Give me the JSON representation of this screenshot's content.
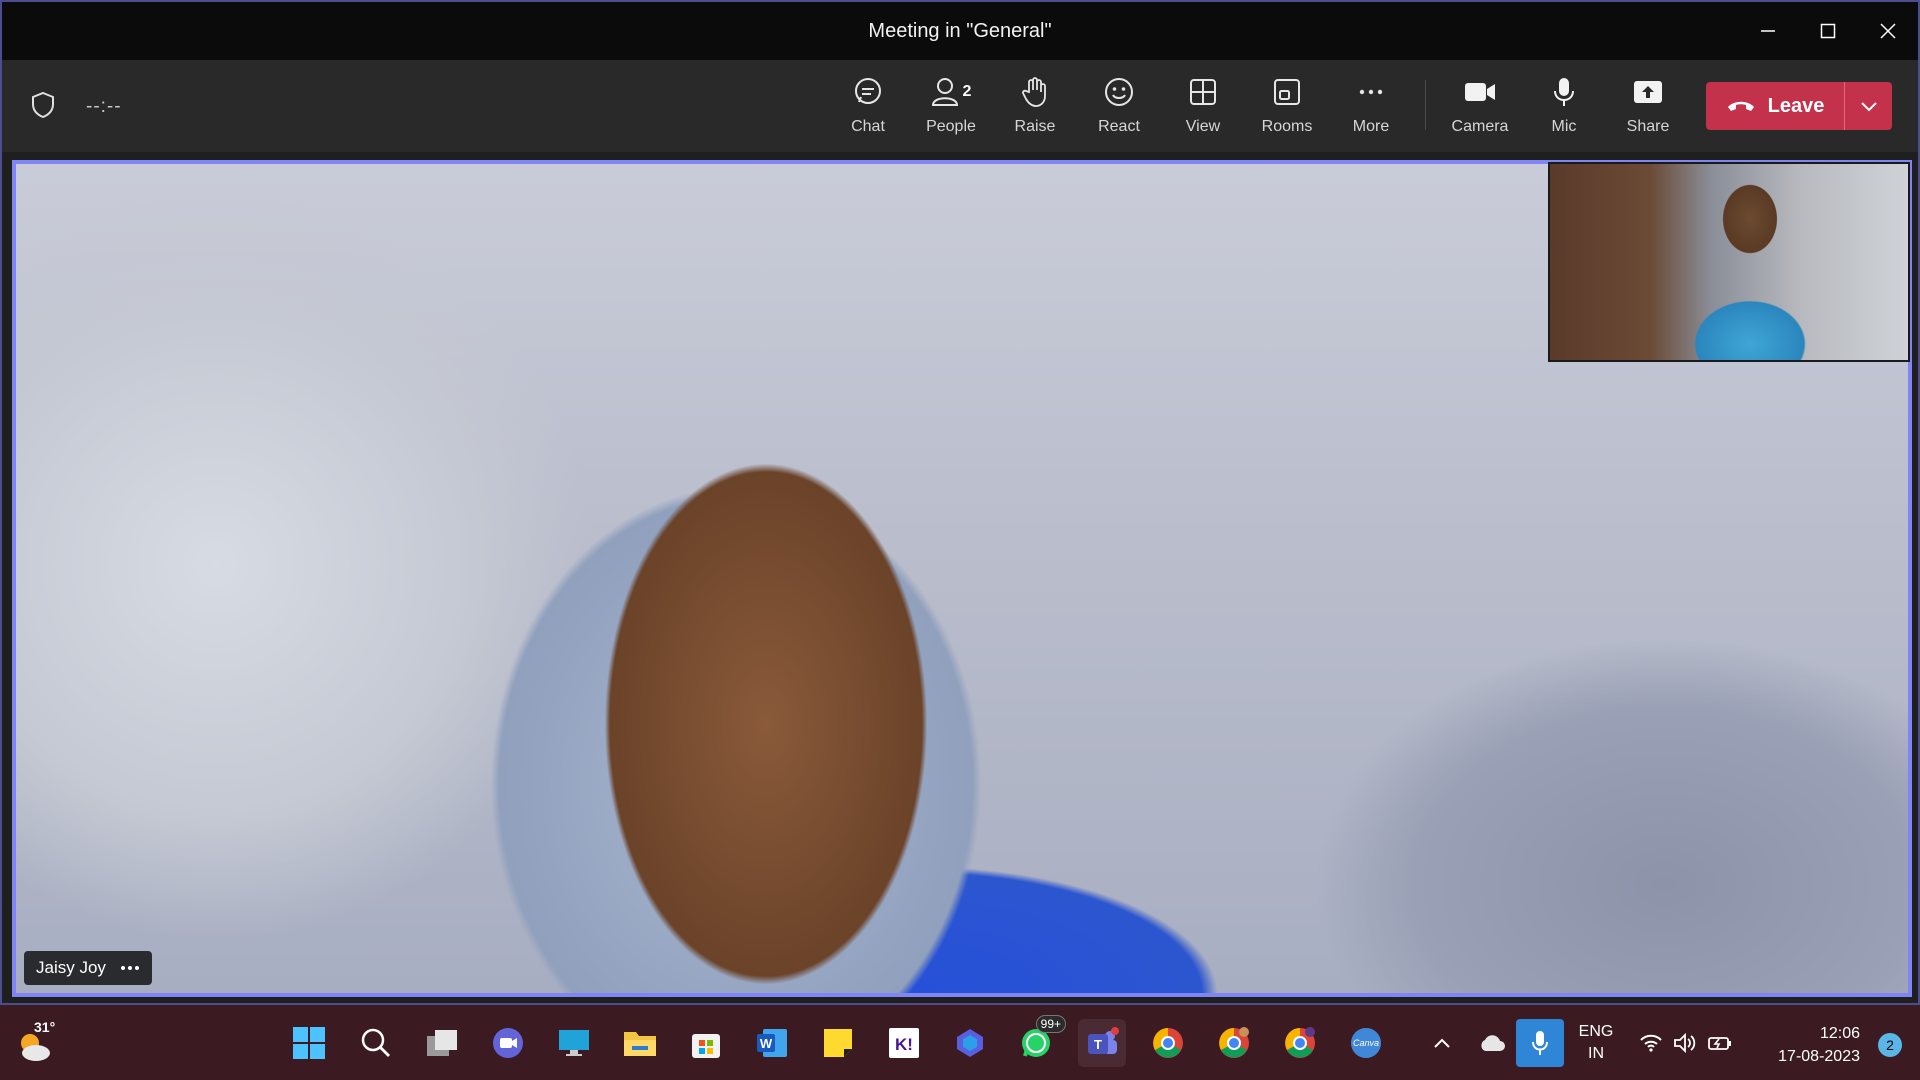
{
  "window": {
    "title": "Meeting in \"General\"",
    "controls": [
      "minimize-icon",
      "maximize-icon",
      "close-icon"
    ]
  },
  "toolbar": {
    "timer": "--:--",
    "buttons": [
      {
        "id": "chat",
        "label": "Chat",
        "icon": "chat-icon"
      },
      {
        "id": "people",
        "label": "People",
        "icon": "people-icon",
        "count": "2"
      },
      {
        "id": "raise",
        "label": "Raise",
        "icon": "hand-icon"
      },
      {
        "id": "react",
        "label": "React",
        "icon": "smile-icon"
      },
      {
        "id": "view",
        "label": "View",
        "icon": "grid-icon"
      },
      {
        "id": "rooms",
        "label": "Rooms",
        "icon": "rooms-icon"
      },
      {
        "id": "more",
        "label": "More",
        "icon": "more-icon"
      },
      {
        "id": "camera",
        "label": "Camera",
        "icon": "camera-icon"
      },
      {
        "id": "mic",
        "label": "Mic",
        "icon": "mic-icon"
      },
      {
        "id": "share",
        "label": "Share",
        "icon": "share-icon"
      }
    ],
    "leave_label": "Leave",
    "leave_color": "#c4314b"
  },
  "stage": {
    "participant_name": "Jaisy Joy",
    "border_color": "#7f85f5"
  },
  "taskbar": {
    "weather_temp": "31°",
    "apps": [
      {
        "id": "start",
        "icon": "windows-icon"
      },
      {
        "id": "search",
        "icon": "search-icon"
      },
      {
        "id": "taskview",
        "icon": "task-view-icon"
      },
      {
        "id": "meet",
        "icon": "video-chat-icon"
      },
      {
        "id": "desktop",
        "icon": "monitor-icon"
      },
      {
        "id": "explorer",
        "icon": "folder-icon"
      },
      {
        "id": "store",
        "icon": "store-icon"
      },
      {
        "id": "word",
        "icon": "word-icon"
      },
      {
        "id": "notes",
        "icon": "sticky-notes-icon"
      },
      {
        "id": "kahoot",
        "icon": "kahoot-icon"
      },
      {
        "id": "copilot",
        "icon": "copilot-icon"
      },
      {
        "id": "whatsapp",
        "icon": "whatsapp-icon",
        "badge": "99+"
      },
      {
        "id": "teams",
        "icon": "teams-icon"
      },
      {
        "id": "chrome1",
        "icon": "chrome-icon"
      },
      {
        "id": "chrome2",
        "icon": "chrome-icon"
      },
      {
        "id": "chrome3",
        "icon": "chrome-icon"
      },
      {
        "id": "canva",
        "icon": "canva-icon",
        "text": "Canva"
      }
    ],
    "lang_top": "ENG",
    "lang_bottom": "IN",
    "time": "12:06",
    "date": "17-08-2023",
    "notifications": "2"
  }
}
